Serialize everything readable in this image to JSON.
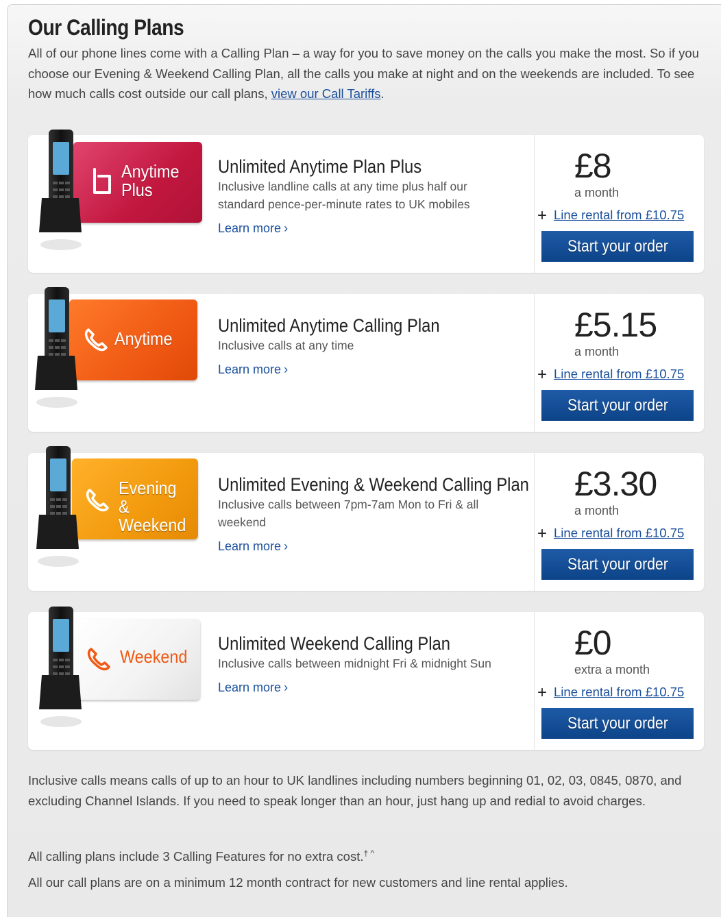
{
  "header": {
    "title": "Our Calling Plans",
    "intro_text": "All of our phone lines come with a Calling Plan – a way for you to save money on the calls you make the most. So if you choose our Evening & Weekend Calling Plan, all the calls you make at night and on the weekends are included. To see how much calls cost outside our call plans, ",
    "intro_link": "view our Call Tariffs",
    "intro_end": "."
  },
  "plans": [
    {
      "badge_line1": "Anytime",
      "badge_line2": "Plus",
      "name": "Unlimited Anytime Plan Plus",
      "description": "Inclusive landline calls at any time plus half our standard pence-per-minute rates to UK mobiles",
      "learn_more": "Learn more",
      "price": "£8",
      "price_sub": "a month",
      "rental_link": "Line rental from £10.75",
      "order_label": "Start your order",
      "badge_color": "#d1224f"
    },
    {
      "badge_line1": "Anytime",
      "name": "Unlimited Anytime Calling Plan",
      "description": "Inclusive calls at any time",
      "learn_more": "Learn more",
      "price": "£5.15",
      "price_sub": "a month",
      "rental_link": "Line rental from £10.75",
      "order_label": "Start your order",
      "badge_color": "#f05a14"
    },
    {
      "badge_line1": "Evening &",
      "badge_line2": "Weekend",
      "name": "Unlimited Evening & Weekend Calling Plan",
      "description": "Inclusive calls between 7pm-7am Mon to Fri & all weekend",
      "learn_more": "Learn more",
      "price": "£3.30",
      "price_sub": "a month",
      "rental_link": "Line rental from £10.75",
      "order_label": "Start your order",
      "badge_color": "#f29a0e"
    },
    {
      "badge_line1": "Weekend",
      "name": "Unlimited Weekend Calling Plan",
      "description": "Inclusive calls between midnight Fri & midnight Sun",
      "learn_more": "Learn more",
      "price": "£0",
      "price_sub": "extra a month",
      "rental_link": "Line rental from £10.75",
      "order_label": "Start your order",
      "badge_color": "#eeeeee"
    }
  ],
  "footer": {
    "note1": "Inclusive calls means calls of up to an hour to UK landlines including numbers beginning 01, 02, 03, 0845, 0870, and excluding Channel Islands. If you need to speak longer than an hour, just hang up and redial to avoid charges.",
    "note2": "All calling plans include 3 Calling Features for no extra cost.",
    "note2_sup": "† ^",
    "note3": "All our call plans are on a minimum 12 month contract for new customers and line rental applies."
  },
  "colors": {
    "link": "#1a4f9c",
    "button": "#0d4489"
  }
}
